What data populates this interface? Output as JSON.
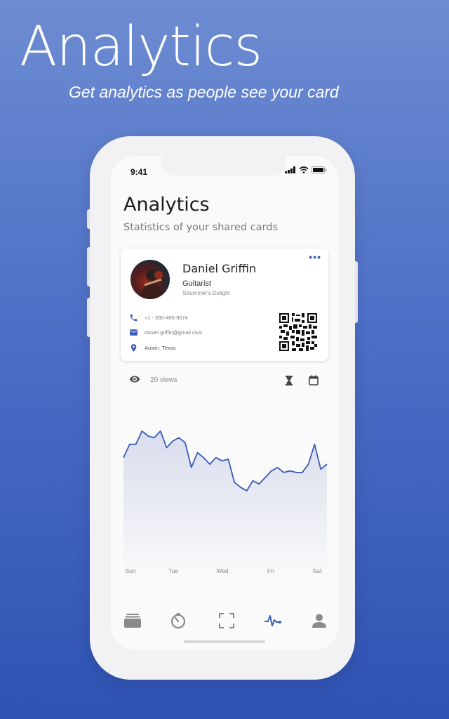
{
  "hero": {
    "title": "Analytics",
    "subtitle": "Get analytics as people see your card"
  },
  "status_bar": {
    "time": "9:41"
  },
  "page": {
    "title": "Analytics",
    "subtitle": "Statistics of your shared cards"
  },
  "card": {
    "name": "Daniel Griffin",
    "role": "Guitarist",
    "company": "Strummer's Delight",
    "phone": "+1 - 530-495-9074",
    "email": "daniel.griffin@gmail.com",
    "location": "Austin, Texas",
    "more_icon": "more-horizontal-icon"
  },
  "stats": {
    "views_label": "20 views"
  },
  "chart_data": {
    "type": "area",
    "x": [
      "Sun",
      "Tue",
      "Wed",
      "Fri",
      "Sat"
    ],
    "series": [
      {
        "values": [
          62,
          70,
          70,
          78,
          75,
          74,
          78,
          68,
          72,
          74,
          71,
          56,
          65,
          62,
          58,
          62,
          60,
          61,
          47,
          44,
          42,
          48,
          46,
          50,
          54,
          56,
          53,
          54,
          53,
          53,
          58,
          70,
          55,
          58
        ]
      }
    ],
    "ylim": [
      0,
      100
    ],
    "grid": false,
    "legend": "none",
    "line_color": "#3a5bb8",
    "fill_color": "#dfe3f1"
  },
  "tabbar": {
    "items": [
      {
        "icon": "cards-icon",
        "active": false
      },
      {
        "icon": "timer-icon",
        "active": false
      },
      {
        "icon": "scan-icon",
        "active": false
      },
      {
        "icon": "analytics-icon",
        "active": true
      },
      {
        "icon": "profile-icon",
        "active": false
      }
    ]
  },
  "colors": {
    "accent": "#3a5bb8",
    "icon_gray": "#7d7d7d"
  }
}
